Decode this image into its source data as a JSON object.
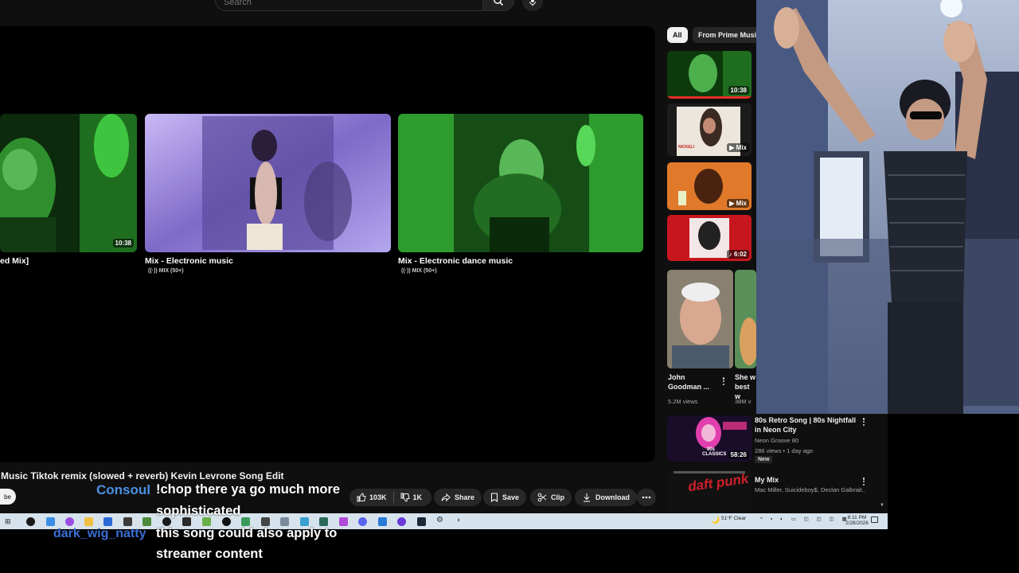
{
  "search": {
    "placeholder": "Search"
  },
  "end_cards": [
    {
      "title": "ed Mix]",
      "duration": "10:38"
    },
    {
      "title": "Mix - Electronic music",
      "sub": "MIX (50+)"
    },
    {
      "title": "Mix - Electronic dance music",
      "sub": "MIX (50+)"
    }
  ],
  "video": {
    "title": "Music Tiktok remix (slowed + reverb) Kevin Levrone Song Edit",
    "subscribe_label": "be",
    "likes": "103K",
    "dislikes": "1K",
    "share_label": "Share",
    "save_label": "Save",
    "clip_label": "Clip",
    "download_label": "Download"
  },
  "sidebar": {
    "chips": [
      "All",
      "From Prime Music"
    ],
    "shorts_thumbs": [
      {
        "duration": "10:38"
      },
      {
        "badge": "Mix",
        "album_text": "NICKELI"
      },
      {
        "badge": "Mix"
      },
      {
        "duration": "6:02"
      }
    ],
    "shorts": [
      {
        "title": "John Goodman ...",
        "views": "5.2M views"
      },
      {
        "title": "She w best w",
        "views": "38M v"
      }
    ],
    "videos": [
      {
        "title": "80s Retro Song | 80s Nightfall in Neon City",
        "channel": "Neon Groove 80",
        "meta": "286 views • 1 day ago",
        "badge": "New",
        "duration": "58:26",
        "thumb_text": "80s CLASSICS"
      },
      {
        "title": "My Mix",
        "channel": "Mac Miller, Suicideboy$, Declan Galbrait..",
        "thumb_text": "daft punk"
      }
    ]
  },
  "taskbar": {
    "weather": "51°F Clear",
    "time": "8:11 PM",
    "date": "2/28/2026"
  },
  "chat": [
    {
      "user": "Consoul",
      "user_color": "#4a90e2",
      "message": "!chop there ya go much more",
      "message_cont": "sophisticated"
    },
    {
      "user": "dark_wig_natty",
      "user_color": "#3b6fd6",
      "message": "this song could also apply to",
      "message_cont": "streamer content"
    }
  ]
}
